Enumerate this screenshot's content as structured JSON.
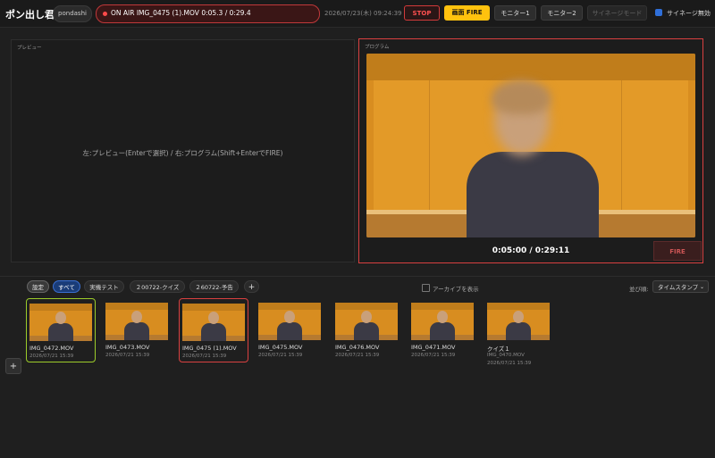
{
  "app": {
    "title": "ポン出し君",
    "user": "pondashi"
  },
  "status": {
    "onair_text": "ON AIR  IMG_0475 (1).MOV 0:05.3 / 0:29.4",
    "datetime": "2026/07/23(木) 09:24:39"
  },
  "toolbar": {
    "stop": "STOP",
    "fire": "画面 FIRE",
    "monitor1": "モニター1",
    "monitor2": "モニター2",
    "signage_mode": "サイネージモード",
    "signage_disable": "サイネージ無効"
  },
  "preview": {
    "label": "プレビュー",
    "hint": "左:プレビュー(Enterで選択) / 右:プログラム(Shift+EnterでFIRE)"
  },
  "program": {
    "label": "プログラム",
    "timecode": "0:05:00 / 0:29:11",
    "fire": "FIRE"
  },
  "tabs": {
    "settings": "設定",
    "all": "すべて",
    "t3": "実機テスト",
    "t4": "２00722-クイズ",
    "t5": "２60722-予告",
    "add": "+"
  },
  "archive": {
    "label": "アーカイブを表示"
  },
  "sort": {
    "label": "並び順:",
    "value": "タイムスタンプ"
  },
  "clips": [
    {
      "name": "IMG_0472.MOV",
      "date": "2026/07/21 15:39",
      "state": "preview"
    },
    {
      "name": "IMG_0473.MOV",
      "date": "2026/07/21 15:39",
      "state": "none"
    },
    {
      "name": "IMG_0475 (1).MOV",
      "date": "2026/07/21 15:39",
      "state": "program"
    },
    {
      "name": "IMG_0475.MOV",
      "date": "2026/07/21 15:39",
      "state": "none"
    },
    {
      "name": "IMG_0476.MOV",
      "date": "2026/07/21 15:39",
      "state": "none"
    },
    {
      "name": "IMG_0471.MOV",
      "date": "2026/07/21 15:39",
      "state": "none"
    },
    {
      "name": "クイズ１",
      "file": "IMG_0470.MOV",
      "date": "2026/07/21 15:39",
      "state": "none"
    }
  ],
  "side": {
    "add": "+"
  },
  "colors": {
    "accent_fire": "#ffc20e",
    "onair_red": "#d94040",
    "preview_green": "#9ccc2a",
    "tab_active": "#3a6fd1"
  }
}
